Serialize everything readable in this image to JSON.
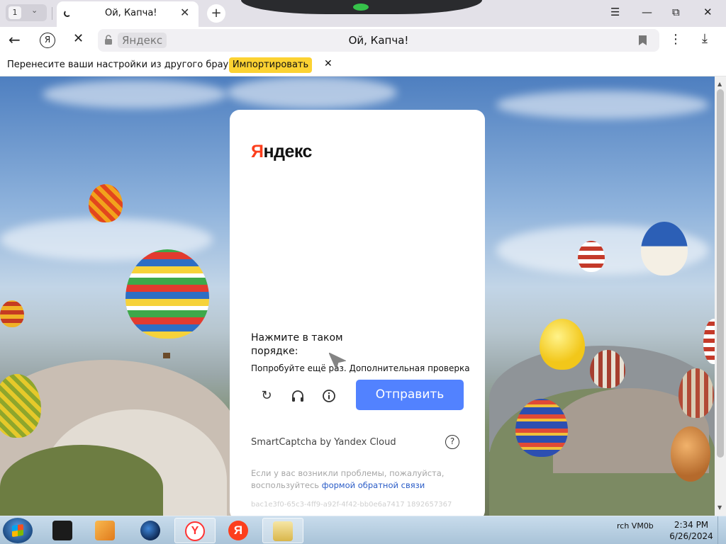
{
  "tabs": {
    "counter": "1",
    "active_title": "Ой, Капча!"
  },
  "address_bar": {
    "host": "Яндекс",
    "page_title": "Ой, Капча!"
  },
  "infobar": {
    "message": "Перенесите ваши настройки из другого браузера.",
    "import_label": "Импортировать"
  },
  "captcha": {
    "logo_first": "Я",
    "logo_rest": "ндекс",
    "instruction": "Нажмите в таком порядке:",
    "retry_message": "Попробуйте ещё раз. Дополнительная проверка",
    "submit_label": "Отправить",
    "brand": "SmartCaptcha by Yandex Cloud",
    "trouble_text": "Если у вас возникли проблемы, пожалуйста, воспользуйтесь ",
    "trouble_link": "формой обратной связи",
    "request_id": "bac1e3f0-65c3-4ff9-a92f-4f42-bb0e6a7417 1892657367"
  },
  "taskbar": {
    "tray_label": "rch VM0b",
    "time": "2:34 PM",
    "date": "6/26/2024"
  },
  "colors": {
    "yandex_red": "#fc3f1d",
    "submit_blue": "#5282ff",
    "import_yellow": "#fcd232",
    "link_blue": "#2a5cc7"
  },
  "icons": [
    "chevron-down-icon",
    "close-icon",
    "plus-icon",
    "hamburger-icon",
    "minimize-icon",
    "restore-icon",
    "back-arrow-icon",
    "yandex-icon",
    "stop-icon",
    "lock-icon",
    "bookmark-icon",
    "kebab-icon",
    "download-icon",
    "refresh-icon",
    "headphones-icon",
    "info-icon",
    "help-icon",
    "windows-start-icon"
  ]
}
